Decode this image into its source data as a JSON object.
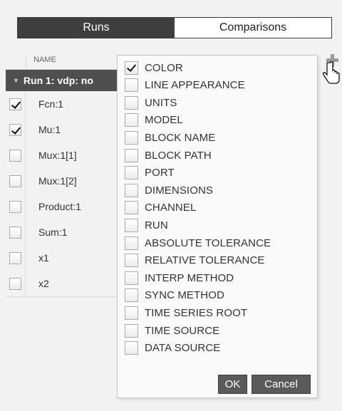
{
  "tabs": {
    "runs": "Runs",
    "comparisons": "Comparisons"
  },
  "table": {
    "header": "NAME",
    "run": "Run 1: vdp: no",
    "rows": [
      {
        "name": "Fcn:1",
        "checked": true
      },
      {
        "name": "Mu:1",
        "checked": true
      },
      {
        "name": "Mux:1[1]",
        "checked": false
      },
      {
        "name": "Mux:1[2]",
        "checked": false
      },
      {
        "name": "Product:1",
        "checked": false
      },
      {
        "name": "Sum:1",
        "checked": false
      },
      {
        "name": "x1",
        "checked": false
      },
      {
        "name": "x2",
        "checked": false
      }
    ]
  },
  "columns_menu": {
    "options": [
      {
        "label": "COLOR",
        "checked": true
      },
      {
        "label": "LINE APPEARANCE",
        "checked": false
      },
      {
        "label": "UNITS",
        "checked": false
      },
      {
        "label": "MODEL",
        "checked": false
      },
      {
        "label": "BLOCK NAME",
        "checked": false
      },
      {
        "label": "BLOCK PATH",
        "checked": false
      },
      {
        "label": "PORT",
        "checked": false
      },
      {
        "label": "DIMENSIONS",
        "checked": false
      },
      {
        "label": "CHANNEL",
        "checked": false
      },
      {
        "label": "RUN",
        "checked": false
      },
      {
        "label": "ABSOLUTE TOLERANCE",
        "checked": false
      },
      {
        "label": "RELATIVE TOLERANCE",
        "checked": false
      },
      {
        "label": "INTERP METHOD",
        "checked": false
      },
      {
        "label": "SYNC METHOD",
        "checked": false
      },
      {
        "label": "TIME SERIES ROOT",
        "checked": false
      },
      {
        "label": "TIME SOURCE",
        "checked": false
      },
      {
        "label": "DATA SOURCE",
        "checked": false
      }
    ],
    "ok": "OK",
    "cancel": "Cancel"
  },
  "icons": {
    "add_column": "plus-icon",
    "cursor": "hand-pointer-icon"
  }
}
